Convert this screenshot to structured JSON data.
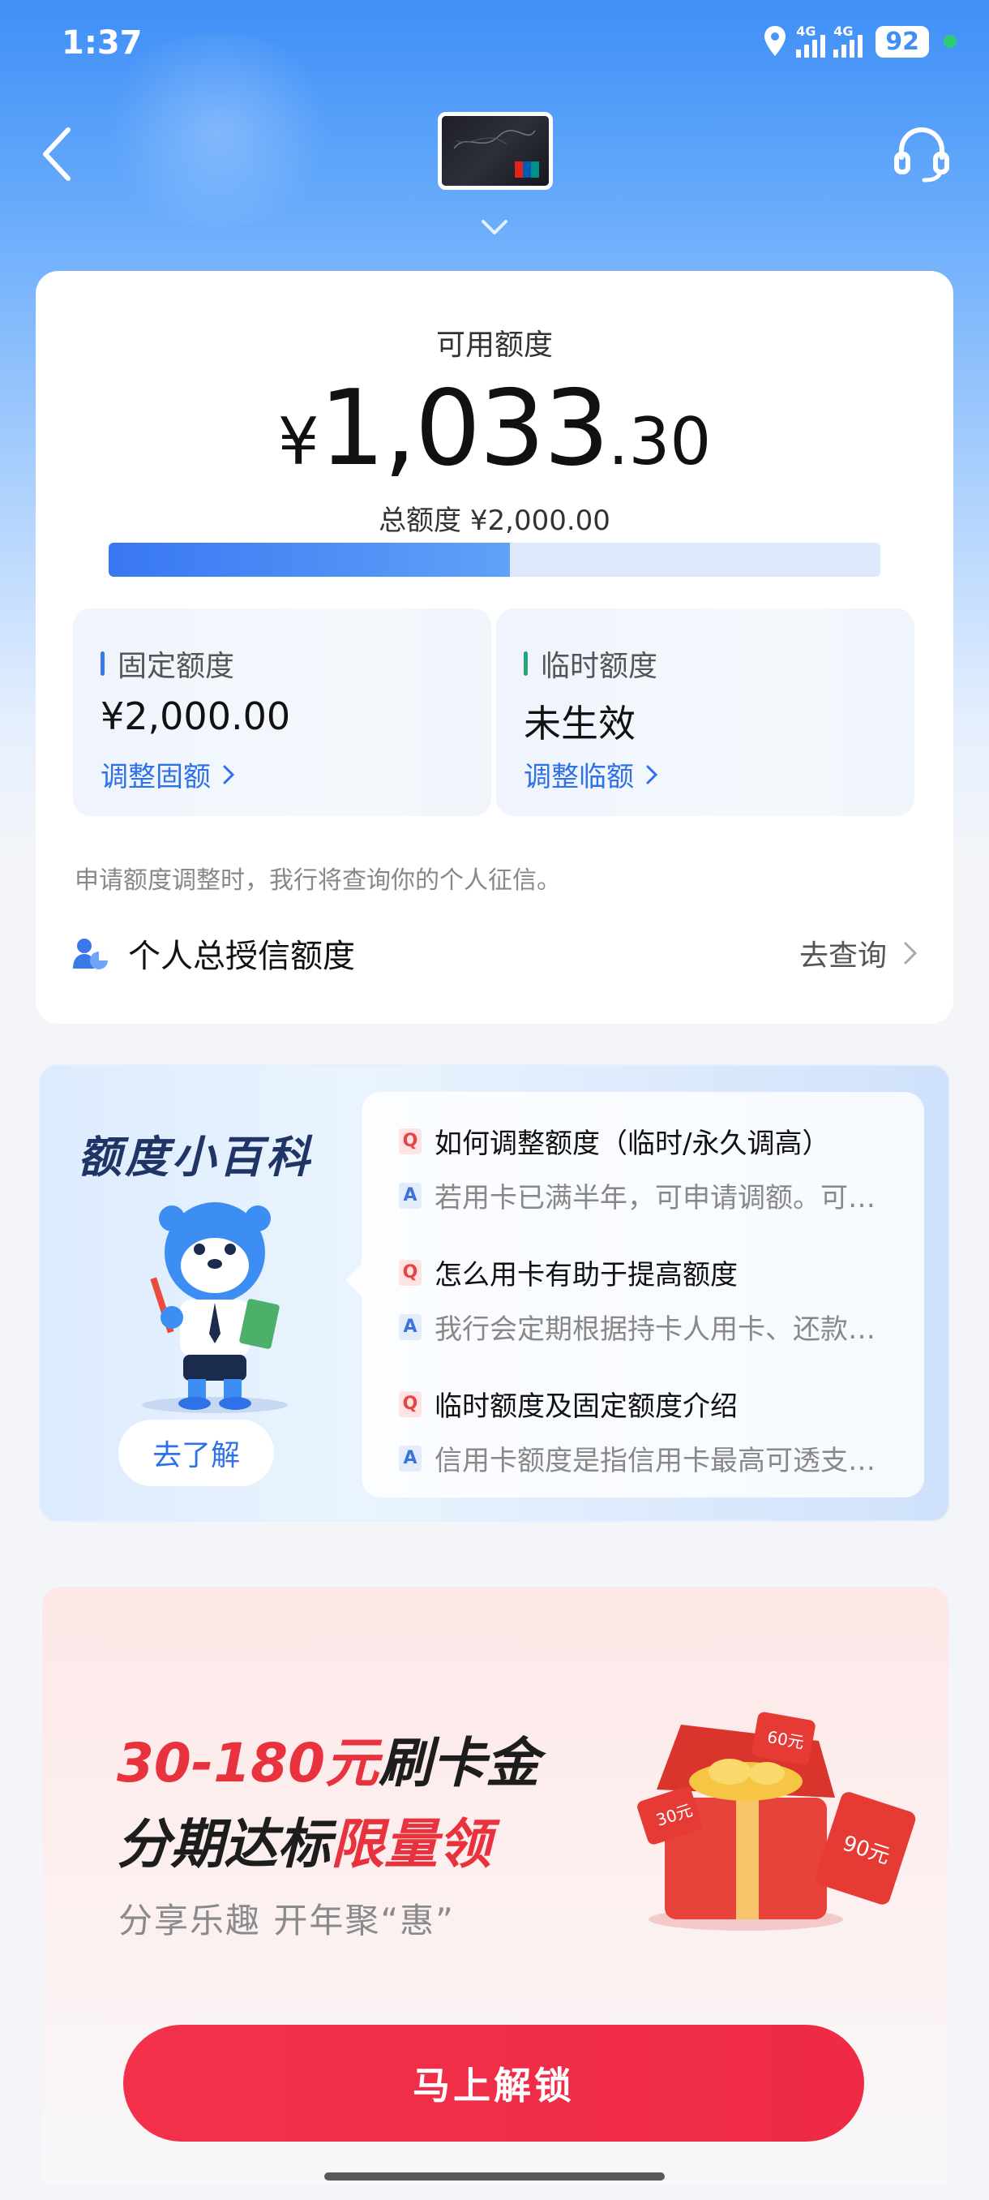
{
  "status_bar": {
    "time": "1:37",
    "network1": "4G",
    "network2": "4G",
    "battery": "92"
  },
  "header": {
    "back": "back",
    "card": "credit-card-thumbnail",
    "support": "customer-service"
  },
  "limit": {
    "available_label": "可用额度",
    "currency": "¥",
    "available_int": "1,033",
    "available_dec": ".30",
    "total_label": "总额度 ¥2,000.00",
    "used_fraction": 0.52,
    "fixed": {
      "title": "固定额度",
      "value": "¥2,000.00",
      "link": "调整固额",
      "accent": "#3b78e8"
    },
    "temp": {
      "title": "临时额度",
      "value": "未生效",
      "link": "调整临额",
      "accent": "#2aa37b"
    },
    "note": "申请额度调整时，我行将查询你的个人征信。",
    "credit_label": "个人总授信额度",
    "credit_action": "去查询"
  },
  "encyclopedia": {
    "title": "额度小百科",
    "button": "去了解",
    "q_badge": "Q",
    "a_badge": "A",
    "items": [
      {
        "q": "如何调整额度（临时/永久调高）",
        "a": "若用卡已满半年，可申请调额。可申请调额。"
      },
      {
        "q": "怎么用卡有助于提高额度",
        "a": "我行会定期根据持卡人用卡、还款情况调整额度"
      },
      {
        "q": "临时额度及固定额度介绍",
        "a": "信用卡额度是指信用卡最高可透支的金额"
      }
    ]
  },
  "promo": {
    "line1_red": "30-180元",
    "line1_dark": "刷卡金",
    "line2_dark": "分期达标",
    "line2_red": "限量领",
    "subtitle": "分享乐趣 开年聚“惠”",
    "gift_tags": [
      "30元",
      "60元",
      "90元"
    ],
    "button": "马上解锁",
    "accent": "#e8323d"
  }
}
